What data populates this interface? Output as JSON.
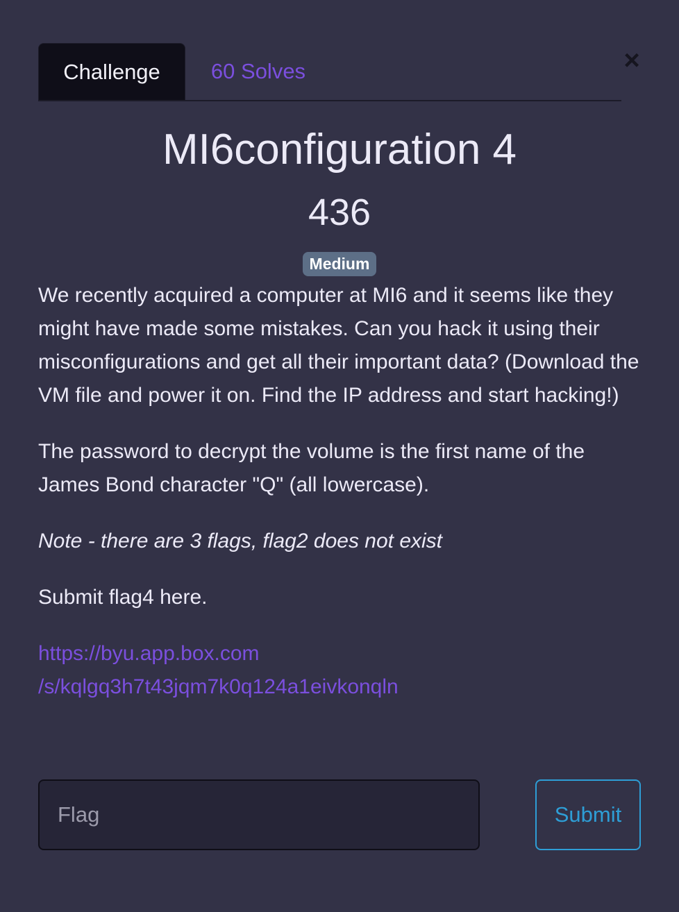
{
  "tabs": {
    "challenge_label": "Challenge",
    "solves_label": "60 Solves"
  },
  "close_glyph": "×",
  "challenge": {
    "title": "MI6configuration 4",
    "points": "436",
    "difficulty": "Medium",
    "description": {
      "paragraph1": "We recently acquired a computer at MI6 and it seems like they might have made some mistakes. Can you hack it using their misconfigurations and get all their important data? (Download the VM file and power it on. Find the IP address and start hacking!)",
      "paragraph2": "The password to decrypt the volume is the first name of the James Bond character \"Q\" (all lowercase).",
      "note": "Note - there are 3 flags, flag2 does not exist",
      "instruction": "Submit flag4 here.",
      "link_line1": "https://byu.app.box.com",
      "link_line2": "/s/kqlgq3h7t43jqm7k0q124a1eivkonqln"
    }
  },
  "form": {
    "flag_placeholder": "Flag",
    "flag_value": "",
    "submit_label": "Submit"
  },
  "colors": {
    "background": "#333247",
    "accent_purple": "#7b4fde",
    "submit_blue": "#2e9ed6",
    "badge_bg": "#5d6f87",
    "active_tab_bg": "#0f0e18"
  }
}
